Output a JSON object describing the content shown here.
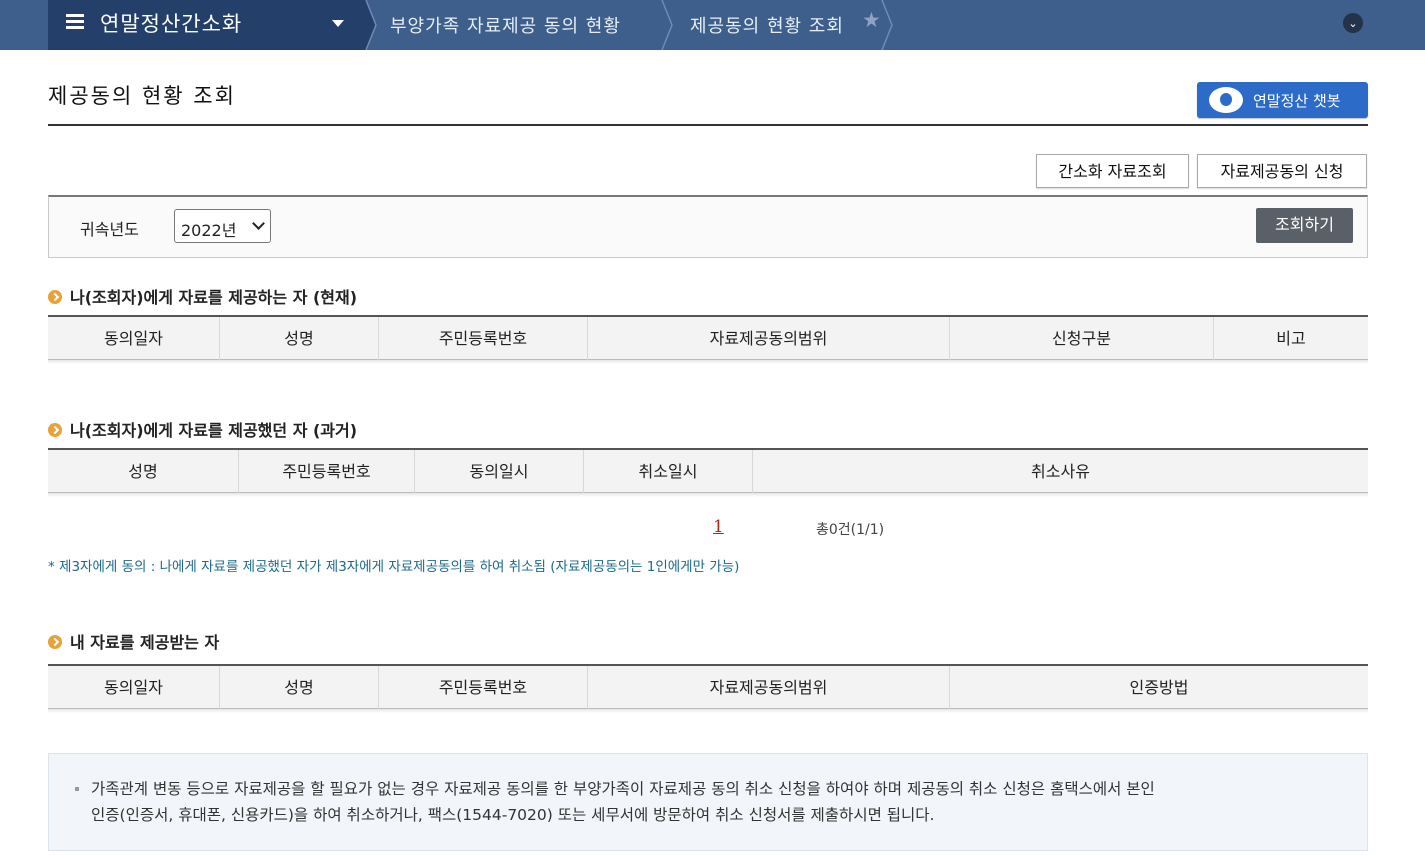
{
  "header": {
    "home_title": "연말정산간소화",
    "crumb1": "부양가족 자료제공 동의 현황",
    "crumb2": "제공동의 현황 조회"
  },
  "page": {
    "title": "제공동의 현황 조회",
    "chatbot_label": "연말정산 챗봇"
  },
  "actions": {
    "simplified_lookup": "간소화 자료조회",
    "consent_apply": "자료제공동의 신청"
  },
  "search": {
    "year_label": "귀속년도",
    "year_value": "2022년",
    "search_button": "조회하기"
  },
  "section1": {
    "title": "나(조회자)에게 자료를 제공하는 자 (현재)",
    "columns": [
      "동의일자",
      "성명",
      "주민등록번호",
      "자료제공동의범위",
      "신청구분",
      "비고"
    ]
  },
  "section2": {
    "title": "나(조회자)에게 자료를 제공했던 자 (과거)",
    "columns": [
      "성명",
      "주민등록번호",
      "동의일시",
      "취소일시",
      "취소사유"
    ],
    "page_number": "1",
    "total": "총0건(1/1)",
    "note": "* 제3자에게 동의 : 나에게 자료를 제공했던 자가 제3자에게 자료제공동의를 하여 취소됨 (자료제공동의는 1인에게만 가능)"
  },
  "section3": {
    "title": "내 자료를 제공받는 자",
    "columns": [
      "동의일자",
      "성명",
      "주민등록번호",
      "자료제공동의범위",
      "인증방법"
    ]
  },
  "info": {
    "line1": "가족관계 변동 등으로 자료제공을 할 필요가 없는 경우 자료제공 동의를 한 부양가족이 자료제공 동의 취소 신청을 하여야 하며 제공동의 취소 신청은 홈택스에서 본인",
    "line2": "인증(인증서, 휴대폰, 신용카드)을 하여 취소하거나, 팩스(1544-7020) 또는 세무서에 방문하여 취소 신청서를 제출하시면 됩니다."
  },
  "icons": {
    "menu": "menu-icon",
    "caret": "caret-down-icon",
    "star": "star-icon",
    "expand": "chevron-down-icon",
    "bullet": "arrow-bullet-icon",
    "chatbot": "chatbot-logo-icon"
  },
  "colors": {
    "topbar": "#3e5f8c",
    "home_bg": "#24406a",
    "chatbot": "#2c6bc8",
    "bullet": "#e8a23a",
    "note": "#1a6a8a",
    "pager": "#b0251a"
  }
}
